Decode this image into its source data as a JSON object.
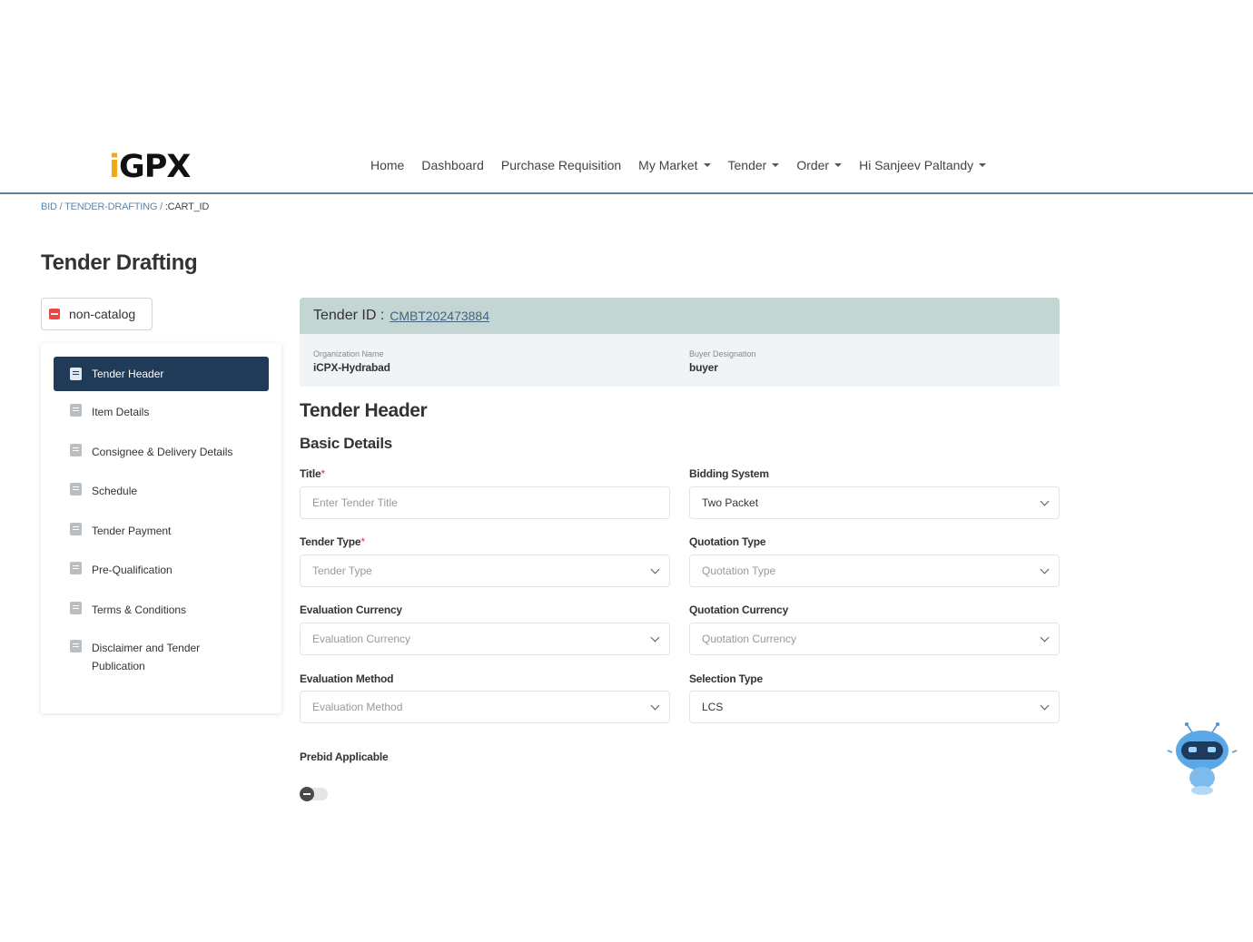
{
  "brand": {
    "logo_text": "GPX",
    "logo_prefix": "i"
  },
  "nav": {
    "items": [
      {
        "label": "Home",
        "dropdown": false
      },
      {
        "label": "Dashboard",
        "dropdown": false
      },
      {
        "label": "Purchase Requisition",
        "dropdown": false
      },
      {
        "label": "My Market",
        "dropdown": true
      },
      {
        "label": "Tender",
        "dropdown": true
      },
      {
        "label": "Order",
        "dropdown": true
      },
      {
        "label": "Hi Sanjeev Paltandy",
        "dropdown": true
      }
    ]
  },
  "breadcrumb": {
    "part1": "BID",
    "sep": " / ",
    "part2": "TENDER-DRAFTING",
    "part3": ":CART_ID"
  },
  "page_title": "Tender Drafting",
  "chip_label": "non-catalog",
  "sidebar": {
    "items": [
      {
        "label": "Tender Header",
        "active": true
      },
      {
        "label": "Item Details",
        "active": false
      },
      {
        "label": "Consignee & Delivery Details",
        "active": false
      },
      {
        "label": "Schedule",
        "active": false
      },
      {
        "label": "Tender Payment",
        "active": false
      },
      {
        "label": "Pre-Qualification",
        "active": false
      },
      {
        "label": "Terms & Conditions",
        "active": false
      },
      {
        "label": "Disclaimer and Tender Publication",
        "active": false
      }
    ]
  },
  "tender": {
    "id_label": "Tender ID :",
    "id_value": "CMBT202473884",
    "org_label": "Organization Name",
    "org_value": "iCPX-Hydrabad",
    "designation_label": "Buyer Designation",
    "designation_value": "buyer"
  },
  "section_title": "Tender Header",
  "subsection_title": "Basic Details",
  "form": {
    "title_label": "Title",
    "title_placeholder": "Enter Tender Title",
    "bidding_label": "Bidding System",
    "bidding_value": "Two Packet",
    "tender_type_label": "Tender Type",
    "tender_type_placeholder": "Tender Type",
    "quotation_type_label": "Quotation Type",
    "quotation_type_placeholder": "Quotation Type",
    "eval_currency_label": "Evaluation Currency",
    "eval_currency_placeholder": "Evaluation Currency",
    "quotation_currency_label": "Quotation Currency",
    "quotation_currency_placeholder": "Quotation Currency",
    "eval_method_label": "Evaluation Method",
    "eval_method_placeholder": "Evaluation Method",
    "selection_type_label": "Selection Type",
    "selection_type_value": "LCS",
    "prebid_label": "Prebid Applicable",
    "required_mark": "*"
  },
  "colors": {
    "accent": "#1f3b57",
    "tender_bar": "#c3d6d4",
    "nav_line": "#5d7f9c",
    "required": "#e33333"
  }
}
